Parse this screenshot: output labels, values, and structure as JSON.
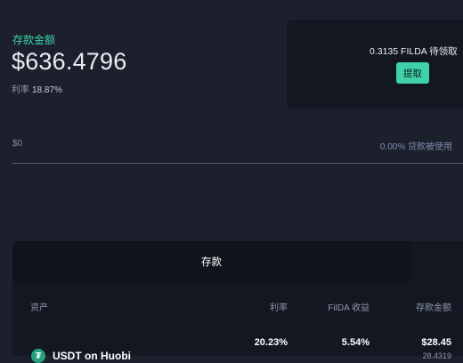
{
  "deposit": {
    "label": "存款金额",
    "amount": "$636.4796",
    "rate_label": "利率",
    "rate_value": "18.87%"
  },
  "reward": {
    "text": "0.3135 FILDA 待领取",
    "claim_label": "提取"
  },
  "utilization": {
    "min_label": "$0",
    "right_label": "0.00% 贷款被使用",
    "fill_fraction": 0.0
  },
  "table": {
    "tab_label": "存款",
    "headers": {
      "asset": "资产",
      "rate": "利率",
      "filda": "FilDA 收益",
      "amount": "存款金额"
    },
    "rows": [
      {
        "asset": "USDT on Huobi",
        "rate": "20.23%",
        "filda": "5.54%",
        "amount": "$28.45",
        "amount_sub": "28.4319"
      }
    ]
  },
  "colors": {
    "accent": "#3fd2a8",
    "background": "#1b202c",
    "card": "#121722"
  }
}
